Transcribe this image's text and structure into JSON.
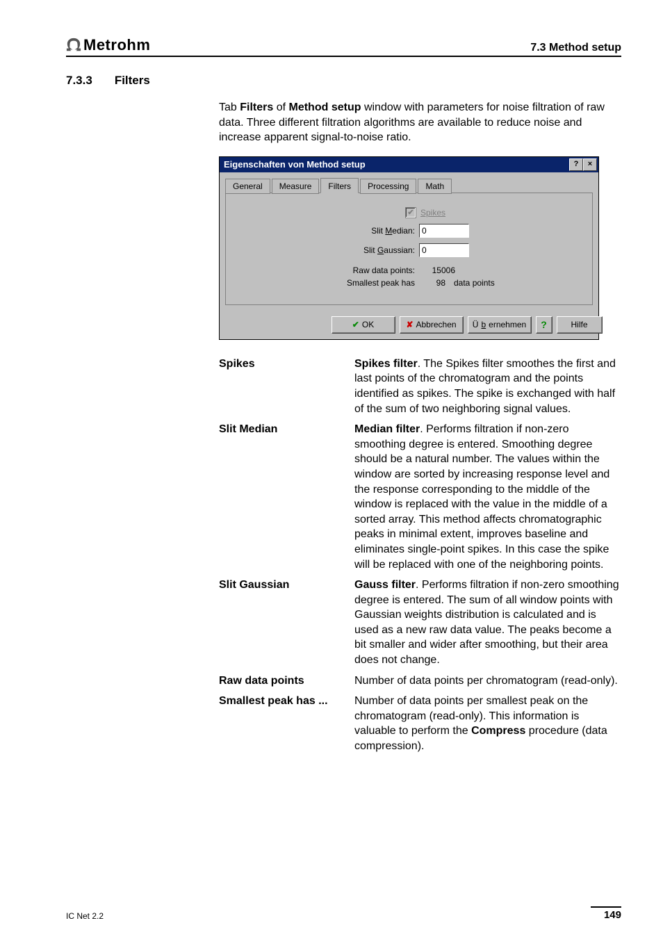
{
  "header": {
    "brand_name": "Metrohm",
    "breadcrumb": "7.3  Method setup"
  },
  "section": {
    "number": "7.3.3",
    "title": "Filters"
  },
  "intro": {
    "prefix": "Tab ",
    "bold1": "Filters",
    "mid": " of ",
    "bold2": "Method setup",
    "rest": " window with parameters for noise filtration of raw data. Three different filtration algorithms are available to reduce noise and increase apparent signal-to-noise ratio."
  },
  "dialog": {
    "title": "Eigenschaften von Method setup",
    "tabs": [
      "General",
      "Measure",
      "Filters",
      "Processing",
      "Math"
    ],
    "active_tab_index": 2,
    "fields": {
      "spikes_label": "Spikes",
      "spikes_checked": true,
      "slit_median_label_pre": "Slit ",
      "slit_median_label_accel": "M",
      "slit_median_label_post": "edian:",
      "slit_median_value": "0",
      "slit_gaussian_label_pre": "Slit ",
      "slit_gaussian_label_accel": "G",
      "slit_gaussian_label_post": "aussian:",
      "slit_gaussian_value": "0",
      "raw_points_label": "Raw data points:",
      "raw_points_value": "15006",
      "smallest_peak_label": "Smallest peak has",
      "smallest_peak_value": "98",
      "smallest_peak_suffix": "data points"
    },
    "buttons": {
      "ok": "OK",
      "cancel": "Abbrechen",
      "apply_pre": "Ü",
      "apply_accel": "b",
      "apply_post": "ernehmen",
      "help": "Hilfe",
      "icon_help": "?",
      "icon_close": "×"
    }
  },
  "definitions": [
    {
      "term": "Spikes",
      "lead_bold": "Spikes filter",
      "desc": ". The Spikes filter smoothes the first and last points of the chromatogram and the points identified as spikes. The spike is exchanged with half of the sum of two neighboring signal values."
    },
    {
      "term": "Slit Median",
      "lead_bold": "Median filter",
      "desc": ". Performs filtration if non-zero smoothing degree is entered. Smoothing degree should be a natural number. The values within the window are sorted by increasing response level and the response corresponding to the middle of the window is replaced with the value in the middle of a sorted array. This method affects chromatographic peaks in minimal extent, improves baseline and eliminates single-point spikes. In this case the spike will be replaced with one of the neighboring points."
    },
    {
      "term": "Slit Gaussian",
      "lead_bold": "Gauss filter",
      "desc": ". Performs filtration if non-zero smoothing degree is entered. The sum of all window points with Gaussian weights distribution is calculated and is used as a new raw data value. The peaks become a bit smaller and wider after smoothing, but their area does not change."
    },
    {
      "term": "Raw data points",
      "lead_bold": "",
      "desc": "Number of data points per chromatogram (read-only)."
    },
    {
      "term": "Smallest peak has ...",
      "lead_bold": "",
      "desc_pre": "Number of data points per smallest peak on the chromatogram (read-only). This information is valuable to perform the ",
      "desc_bold": "Compress",
      "desc_post": " procedure (data compression)."
    }
  ],
  "footer": {
    "product": "IC Net 2.2",
    "page": "149"
  }
}
